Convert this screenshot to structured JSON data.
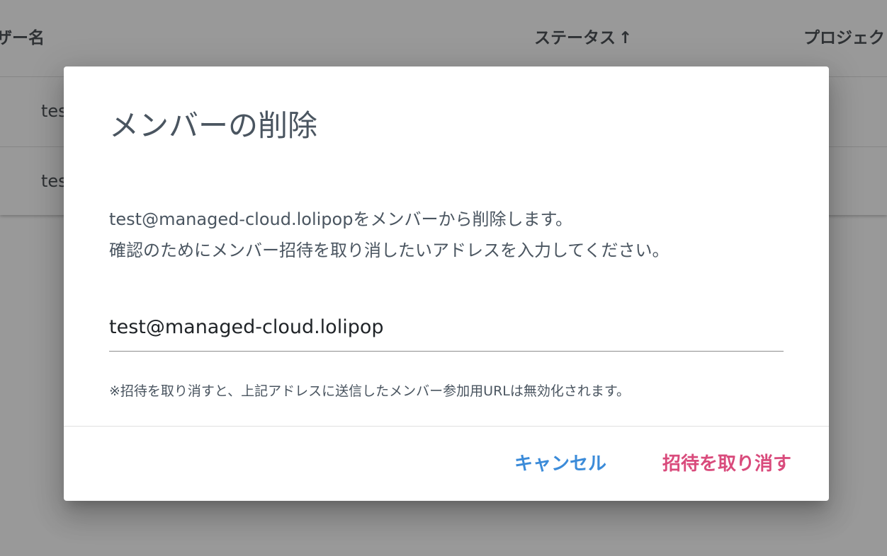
{
  "background": {
    "columns": {
      "username": "ザー名",
      "status": "ステータス",
      "status_sort_icon": "↑",
      "project": "プロジェク"
    },
    "rows": [
      {
        "username": "tes"
      },
      {
        "username": "tes"
      }
    ]
  },
  "dialog": {
    "title": "メンバーの削除",
    "message_line1": "test@managed-cloud.lolipopをメンバーから削除します。",
    "message_line2": "確認のためにメンバー招待を取り消したいアドレスを入力してください。",
    "input_value": "test@managed-cloud.lolipop",
    "note": "※招待を取り消すと、上記アドレスに送信したメンバー参加用URLは無効化されます。",
    "cancel_label": "キャンセル",
    "revoke_label": "招待を取り消す"
  },
  "colors": {
    "cancel": "#3b8bd9",
    "revoke": "#d94b7c",
    "text": "#4a5560",
    "scrim": "rgba(33,33,33,0.46)"
  }
}
